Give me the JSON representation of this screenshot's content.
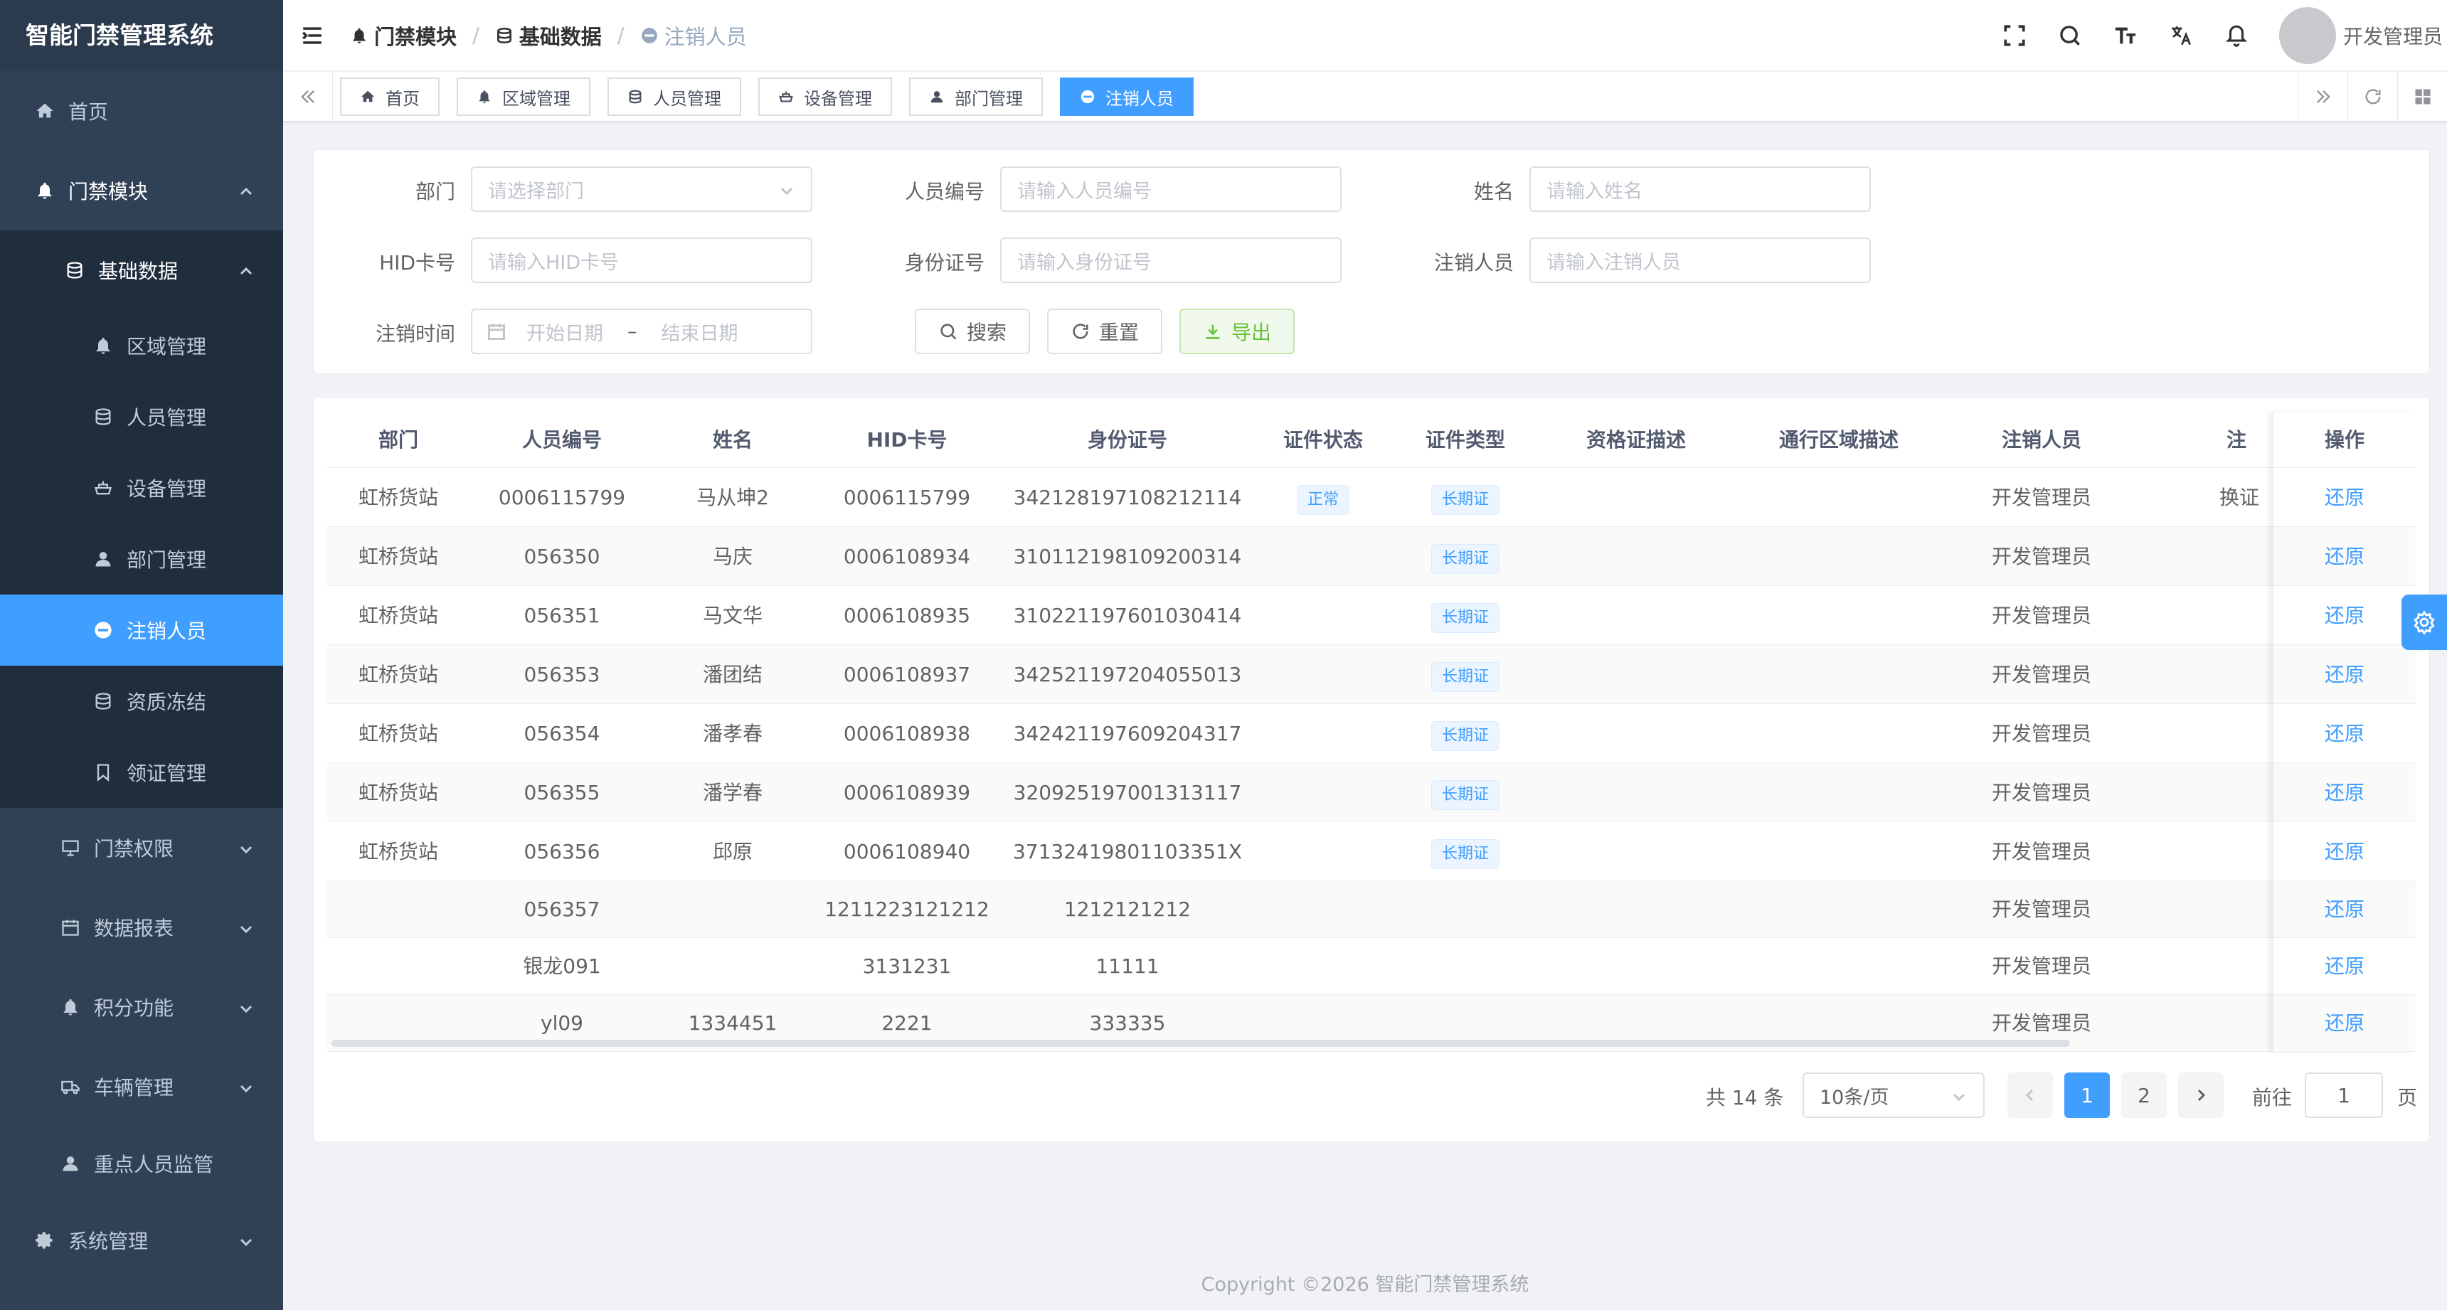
{
  "sidebar": {
    "title": "智能门禁管理系统",
    "items": {
      "home": "首页",
      "access_module": "门禁模块",
      "basic_data": "基础数据",
      "area": "区域管理",
      "person": "人员管理",
      "device": "设备管理",
      "dept": "部门管理",
      "cancelled": "注销人员",
      "freeze": "资质冻结",
      "license": "领证管理",
      "permission": "门禁权限",
      "report": "数据报表",
      "points": "积分功能",
      "vehicle": "车辆管理",
      "key_person": "重点人员监管",
      "system": "系统管理"
    }
  },
  "header": {
    "breadcrumb": [
      "门禁模块",
      "基础数据",
      "注销人员"
    ],
    "username": "开发管理员"
  },
  "tags": [
    "首页",
    "区域管理",
    "人员管理",
    "设备管理",
    "部门管理",
    "注销人员"
  ],
  "search": {
    "dept_label": "部门",
    "dept_placeholder": "请选择部门",
    "emp_no_label": "人员编号",
    "emp_no_placeholder": "请输入人员编号",
    "name_label": "姓名",
    "name_placeholder": "请输入姓名",
    "hid_label": "HID卡号",
    "hid_placeholder": "请输入HID卡号",
    "id_label": "身份证号",
    "id_placeholder": "请输入身份证号",
    "canceller_label": "注销人员",
    "canceller_placeholder": "请输入注销人员",
    "time_label": "注销时间",
    "start_placeholder": "开始日期",
    "date_sep": "–",
    "end_placeholder": "结束日期",
    "btn_search": "搜索",
    "btn_reset": "重置",
    "btn_export": "导出"
  },
  "table": {
    "headers": [
      "部门",
      "人员编号",
      "姓名",
      "HID卡号",
      "身份证号",
      "证件状态",
      "证件类型",
      "资格证描述",
      "通行区域描述",
      "注销人员",
      "注",
      "操作"
    ],
    "rows": [
      {
        "dept": "虹桥货站",
        "no": "0006115799",
        "name": "马从坤2",
        "hid": "0006115799",
        "idcard": "342128197108212114",
        "status": "正常",
        "type": "长期证",
        "canceller": "开发管理员",
        "reason": "换证",
        "op": "还原"
      },
      {
        "dept": "虹桥货站",
        "no": "056350",
        "name": "马庆",
        "hid": "0006108934",
        "idcard": "310112198109200314",
        "status": "",
        "type": "长期证",
        "canceller": "开发管理员",
        "reason": "",
        "op": "还原"
      },
      {
        "dept": "虹桥货站",
        "no": "056351",
        "name": "马文华",
        "hid": "0006108935",
        "idcard": "310221197601030414",
        "status": "",
        "type": "长期证",
        "canceller": "开发管理员",
        "reason": "",
        "op": "还原"
      },
      {
        "dept": "虹桥货站",
        "no": "056353",
        "name": "潘团结",
        "hid": "0006108937",
        "idcard": "342521197204055013",
        "status": "",
        "type": "长期证",
        "canceller": "开发管理员",
        "reason": "",
        "op": "还原"
      },
      {
        "dept": "虹桥货站",
        "no": "056354",
        "name": "潘孝春",
        "hid": "0006108938",
        "idcard": "342421197609204317",
        "status": "",
        "type": "长期证",
        "canceller": "开发管理员",
        "reason": "",
        "op": "还原"
      },
      {
        "dept": "虹桥货站",
        "no": "056355",
        "name": "潘学春",
        "hid": "0006108939",
        "idcard": "320925197001313117",
        "status": "",
        "type": "长期证",
        "canceller": "开发管理员",
        "reason": "",
        "op": "还原"
      },
      {
        "dept": "虹桥货站",
        "no": "056356",
        "name": "邱原",
        "hid": "0006108940",
        "idcard": "37132419801103351X",
        "status": "",
        "type": "长期证",
        "canceller": "开发管理员",
        "reason": "",
        "op": "还原"
      },
      {
        "dept": "",
        "no": "056357",
        "name": "",
        "hid": "1211223121212",
        "idcard": "1212121212",
        "status": "",
        "type": "",
        "canceller": "开发管理员",
        "reason": "",
        "op": "还原"
      },
      {
        "dept": "",
        "no": "银龙091",
        "name": "",
        "hid": "3131231",
        "idcard": "11111",
        "status": "",
        "type": "",
        "canceller": "开发管理员",
        "reason": "",
        "op": "还原"
      },
      {
        "dept": "",
        "no": "yl09",
        "name": "1334451",
        "hid": "2221",
        "idcard": "333335",
        "status": "",
        "type": "",
        "canceller": "开发管理员",
        "reason": "",
        "op": "还原"
      }
    ]
  },
  "pagination": {
    "total": "共 14 条",
    "page_size": "10条/页",
    "pages": [
      "1",
      "2"
    ],
    "goto_label": "前往",
    "goto_value": "1",
    "goto_unit": "页"
  },
  "footer": "Copyright ©2026 智能门禁管理系统",
  "colors": {
    "primary": "#409eff",
    "sidebar": "#304156",
    "success": "#67c23a"
  }
}
